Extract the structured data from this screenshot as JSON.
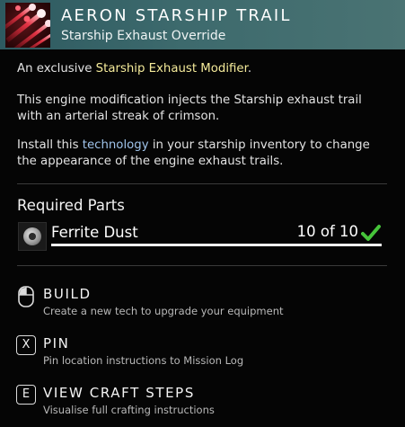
{
  "header": {
    "title": "AERON STARSHIP TRAIL",
    "subtitle": "Starship Exhaust Override"
  },
  "description": {
    "line1_prefix": "An exclusive ",
    "line1_highlight": "Starship Exhaust Modifier",
    "line1_suffix": ".",
    "para2": "This engine modification injects the Starship exhaust trail with an arterial streak of crimson.",
    "para3_prefix": "Install this ",
    "para3_highlight": "technology",
    "para3_suffix": " in your starship inventory to change the appearance of the engine exhaust trails."
  },
  "required_parts": {
    "title": "Required Parts",
    "items": [
      {
        "name": "Ferrite Dust",
        "count": "10 of 10",
        "progress": 1.0,
        "icon": "ferrite-dust-icon",
        "status_icon": "check-icon"
      }
    ]
  },
  "actions": [
    {
      "key": "mouse-icon",
      "label": "BUILD",
      "sub": "Create a new tech to upgrade your equipment"
    },
    {
      "key": "X",
      "label": "PIN",
      "sub": "Pin location instructions to Mission Log"
    },
    {
      "key": "E",
      "label": "VIEW CRAFT STEPS",
      "sub": "Visualise full crafting instructions"
    }
  ],
  "colors": {
    "header_bg": "#3d6a6d",
    "highlight_yellow": "#f4ea9a",
    "highlight_blue": "#9fc3ea",
    "check_green": "#46c43a",
    "item_icon_red": "#e8283a"
  }
}
